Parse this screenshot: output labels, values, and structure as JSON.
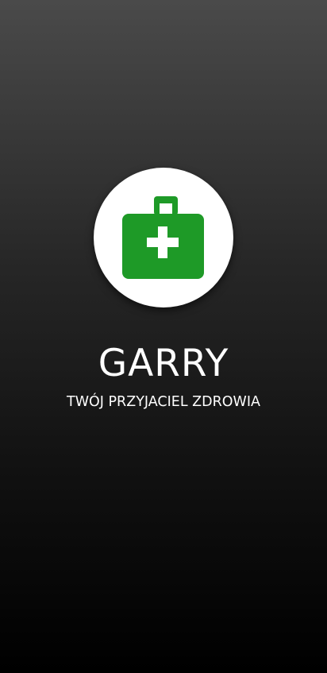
{
  "app": {
    "title": "GARRY",
    "subtitle": "TWÓJ PRZYJACIEL ZDROWIA"
  },
  "logo": {
    "icon": "medical-kit-icon",
    "icon_color": "#1e9a27",
    "background": "#ffffff"
  }
}
